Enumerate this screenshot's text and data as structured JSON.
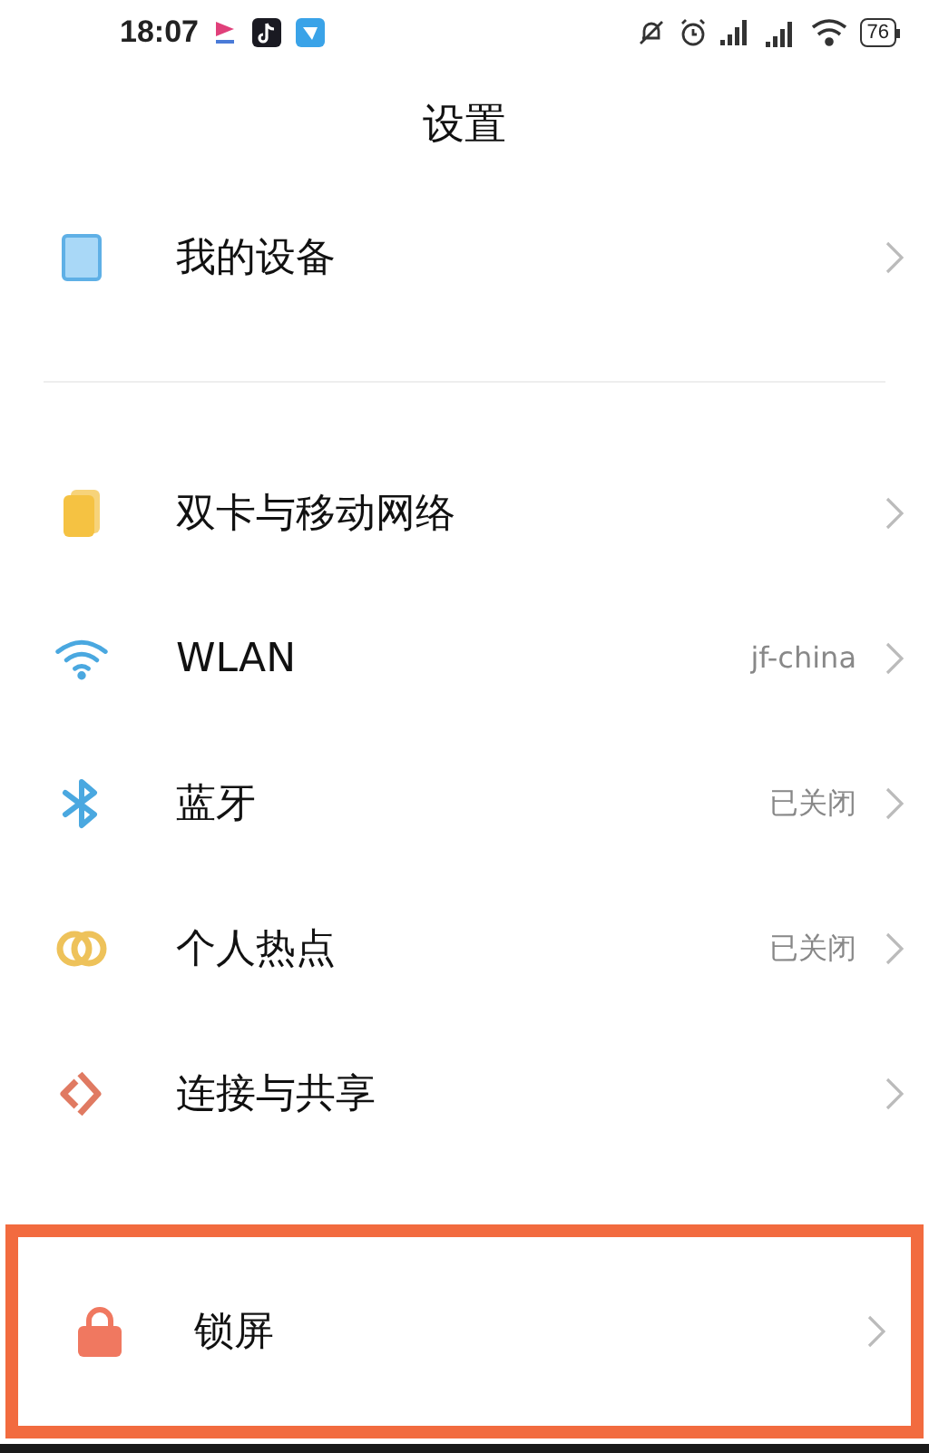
{
  "status_bar": {
    "time": "18:07",
    "battery": "76"
  },
  "title": "设置",
  "sections": [
    {
      "items": [
        {
          "kind": "device",
          "label": "我的设备",
          "highlighted": false
        }
      ]
    },
    {
      "items": [
        {
          "kind": "sim",
          "label": "双卡与移动网络",
          "highlighted": false
        },
        {
          "kind": "wifi",
          "label": "WLAN",
          "value": "jf-china",
          "highlighted": false
        },
        {
          "kind": "bluetooth",
          "label": "蓝牙",
          "value": "已关闭",
          "highlighted": false
        },
        {
          "kind": "hotspot",
          "label": "个人热点",
          "value": "已关闭",
          "highlighted": false
        },
        {
          "kind": "share",
          "label": "连接与共享",
          "highlighted": false
        }
      ]
    },
    {
      "items": [
        {
          "kind": "lock",
          "label": "锁屏",
          "highlighted": true
        }
      ]
    }
  ]
}
